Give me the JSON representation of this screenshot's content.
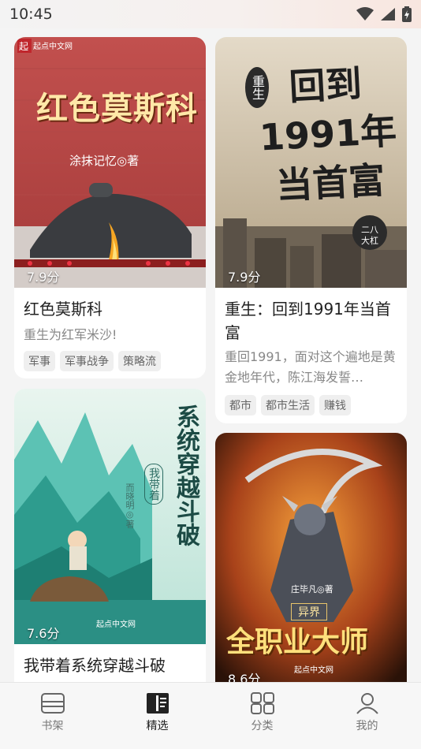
{
  "status": {
    "time": "10:45"
  },
  "books": [
    {
      "score": "7.9分",
      "title": "红色莫斯科",
      "desc": "重生为红军米沙!",
      "tags": [
        "军事",
        "军事战争",
        "策略流"
      ],
      "cover_title": "红色莫斯科",
      "cover_author": "涂抹记忆◎著",
      "publisher": "起点中文网"
    },
    {
      "score": "7.9分",
      "title": "重生：回到1991年当首富",
      "desc": "重回1991，面对这个遍地是黄金地年代，陈江海发誓…",
      "tags": [
        "都市",
        "都市生活",
        "赚钱"
      ],
      "cover_title": "回到1991年当首富",
      "cover_prefix": "重生",
      "cover_author": "二八大杠"
    },
    {
      "score": "7.6分",
      "title": "我带着系统穿越斗破",
      "cover_title": "系统穿越斗破",
      "cover_badge": "我带着",
      "cover_author": "而晓明◎著",
      "publisher": "起点中文网"
    },
    {
      "score": "8.6分",
      "cover_title": "全职业大师",
      "cover_sub": "异界",
      "cover_author": "庄毕凡◎著",
      "publisher": "起点中文网"
    }
  ],
  "tabs": [
    {
      "label": "书架",
      "icon": "bookshelf-icon"
    },
    {
      "label": "精选",
      "icon": "book-open-icon"
    },
    {
      "label": "分类",
      "icon": "grid-icon"
    },
    {
      "label": "我的",
      "icon": "user-icon"
    }
  ],
  "colors": {
    "accent": "#222222",
    "tag_bg": "#efefef",
    "muted": "#888888"
  }
}
